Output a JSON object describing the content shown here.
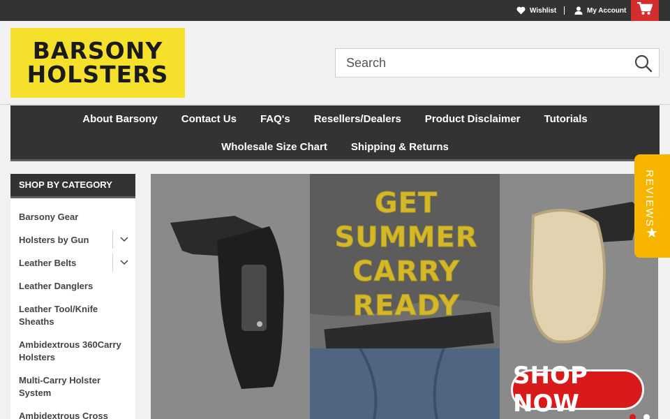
{
  "topbar": {
    "wishlist_label": "Wishlist",
    "account_label": "My Account",
    "wishlist_icon": "heart-icon",
    "account_icon": "user-icon",
    "cart_icon": "cart-icon"
  },
  "header": {
    "logo_line1": "BARSONY",
    "logo_line2": "HOLSTERS",
    "search_placeholder": "Search",
    "search_icon": "magnifier-icon"
  },
  "nav": {
    "row1": [
      "About Barsony",
      "Contact Us",
      "FAQ's",
      "Resellers/Dealers",
      "Product Disclaimer",
      "Tutorials"
    ],
    "row2": [
      "Wholesale Size Chart",
      "Shipping & Returns"
    ]
  },
  "sidebar": {
    "title": "Shop By Category",
    "items": [
      {
        "label": "Barsony Gear",
        "expandable": false
      },
      {
        "label": "Holsters by Gun",
        "expandable": true
      },
      {
        "label": "Leather Belts",
        "expandable": true
      },
      {
        "label": "Leather Danglers",
        "expandable": false
      },
      {
        "label": "Leather Tool/Knife Sheaths",
        "expandable": false
      },
      {
        "label": "Ambidextrous 360Carry Holsters",
        "expandable": false
      },
      {
        "label": "Multi-Carry Holster System",
        "expandable": false
      },
      {
        "label": "Ambidextrous Cross Draw",
        "expandable": false
      }
    ]
  },
  "hero": {
    "headline_lines": [
      "GET",
      "SUMMER",
      "CARRY",
      "READY"
    ],
    "cta_label": "SHOP NOW",
    "active_slide": 1,
    "slide_count": 2
  },
  "reviews_tab": {
    "label": "REVIEWS",
    "icon": "star-icon"
  },
  "colors": {
    "dark_bar": "#333333",
    "logo_yellow": "#f5e12c",
    "cart_red": "#d42d2d",
    "cta_red": "#d81a1a",
    "headline_gold": "#d4b82a",
    "reviews_orange": "#f7b500"
  }
}
